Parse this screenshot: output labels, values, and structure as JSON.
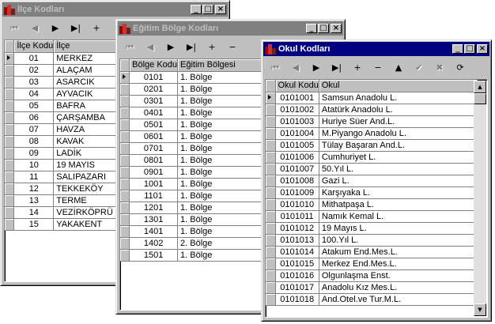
{
  "icons": {
    "first": "⏮",
    "prior": "◀",
    "next": "▶",
    "last": "▶|",
    "insert": "+",
    "delete": "−",
    "edit": "▲",
    "post": "✔",
    "cancel": "✖",
    "refresh": "⟳",
    "minimize": "_",
    "maximize": "□",
    "close": "×",
    "scroll_up": "▲",
    "scroll_down": "▼"
  },
  "ilce_window": {
    "title": "İlçe Kodları",
    "columns": [
      "İlçe Kodu",
      "İlçe"
    ],
    "rows": [
      [
        "01",
        "MERKEZ"
      ],
      [
        "02",
        "ALAÇAM"
      ],
      [
        "03",
        "ASARCIK"
      ],
      [
        "04",
        "AYVACIK"
      ],
      [
        "05",
        "BAFRA"
      ],
      [
        "06",
        "ÇARŞAMBA"
      ],
      [
        "07",
        "HAVZA"
      ],
      [
        "08",
        "KAVAK"
      ],
      [
        "09",
        "LADİK"
      ],
      [
        "10",
        "19 MAYIS"
      ],
      [
        "11",
        "SALIPAZARI"
      ],
      [
        "12",
        "TEKKEKÖY"
      ],
      [
        "13",
        "TERME"
      ],
      [
        "14",
        "VEZİRKÖPRÜ"
      ],
      [
        "15",
        "YAKAKENT"
      ]
    ]
  },
  "bolge_window": {
    "title": "Eğitim Bölge Kodları",
    "columns": [
      "Bölge Kodu",
      "Eğitim Bölgesi"
    ],
    "rows": [
      [
        "0101",
        "1. Bölge"
      ],
      [
        "0201",
        "1. Bölge"
      ],
      [
        "0301",
        "1. Bölge"
      ],
      [
        "0401",
        "1. Bölge"
      ],
      [
        "0501",
        "1. Bölge"
      ],
      [
        "0601",
        "1. Bölge"
      ],
      [
        "0701",
        "1. Bölge"
      ],
      [
        "0801",
        "1. Bölge"
      ],
      [
        "0901",
        "1. Bölge"
      ],
      [
        "1001",
        "1. Bölge"
      ],
      [
        "1101",
        "1. Bölge"
      ],
      [
        "1201",
        "1. Bölge"
      ],
      [
        "1301",
        "1. Bölge"
      ],
      [
        "1401",
        "1. Bölge"
      ],
      [
        "1402",
        "2. Bölge"
      ],
      [
        "1501",
        "1. Bölge"
      ]
    ]
  },
  "okul_window": {
    "title": "Okul Kodları",
    "columns": [
      "Okul Kodu",
      "Okul"
    ],
    "rows": [
      [
        "0101001",
        "Samsun Anadolu L."
      ],
      [
        "0101002",
        "Atatürk Anadolu L."
      ],
      [
        "0101003",
        "Huriye Süer And.L."
      ],
      [
        "0101004",
        "M.Piyango Anadolu L."
      ],
      [
        "0101005",
        "Tülay Başaran And.L."
      ],
      [
        "0101006",
        "Cumhuriyet L."
      ],
      [
        "0101007",
        "50.Yıl L."
      ],
      [
        "0101008",
        "Gazi L."
      ],
      [
        "0101009",
        "Karşıyaka L."
      ],
      [
        "0101010",
        "Mithatpaşa L."
      ],
      [
        "0101011",
        "Namık Kemal L."
      ],
      [
        "0101012",
        "19 Mayıs L."
      ],
      [
        "0101013",
        "100.Yıl L."
      ],
      [
        "0101014",
        "Atakum End.Mes.L."
      ],
      [
        "0101015",
        "Merkez End.Mes.L."
      ],
      [
        "0101016",
        "Olgunlaşma Enst."
      ],
      [
        "0101017",
        "Anadolu Kız Mes.L."
      ],
      [
        "0101018",
        "And.Otel.ve Tur.M.L."
      ]
    ]
  }
}
